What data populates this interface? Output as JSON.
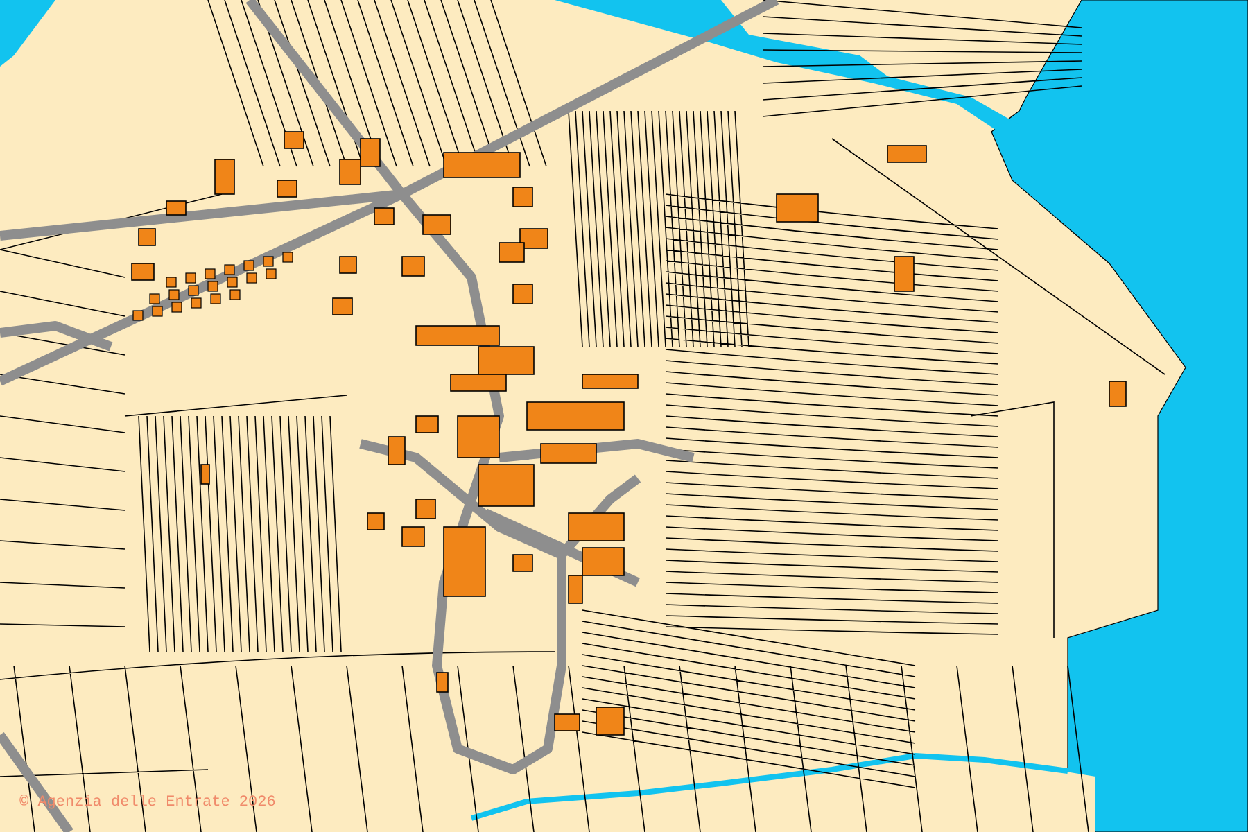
{
  "map": {
    "attribution": "© Agenzia delle Entrate 2026"
  }
}
